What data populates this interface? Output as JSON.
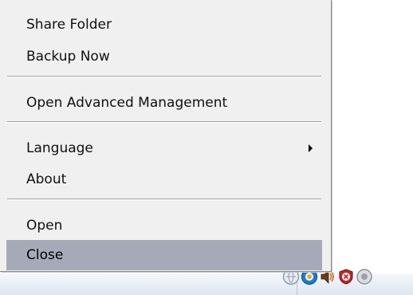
{
  "menu": {
    "items": [
      {
        "label": "Share Folder"
      },
      {
        "label": "Backup Now"
      },
      {
        "label": "Open Advanced Management"
      },
      {
        "label": "Language"
      },
      {
        "label": "About"
      },
      {
        "label": "Open"
      },
      {
        "label": "Close"
      }
    ],
    "selected": "Close"
  },
  "tray": {
    "icons": [
      "network-globe-icon",
      "app-sync-icon",
      "volume-icon",
      "security-shield-icon",
      "info-icon"
    ]
  }
}
